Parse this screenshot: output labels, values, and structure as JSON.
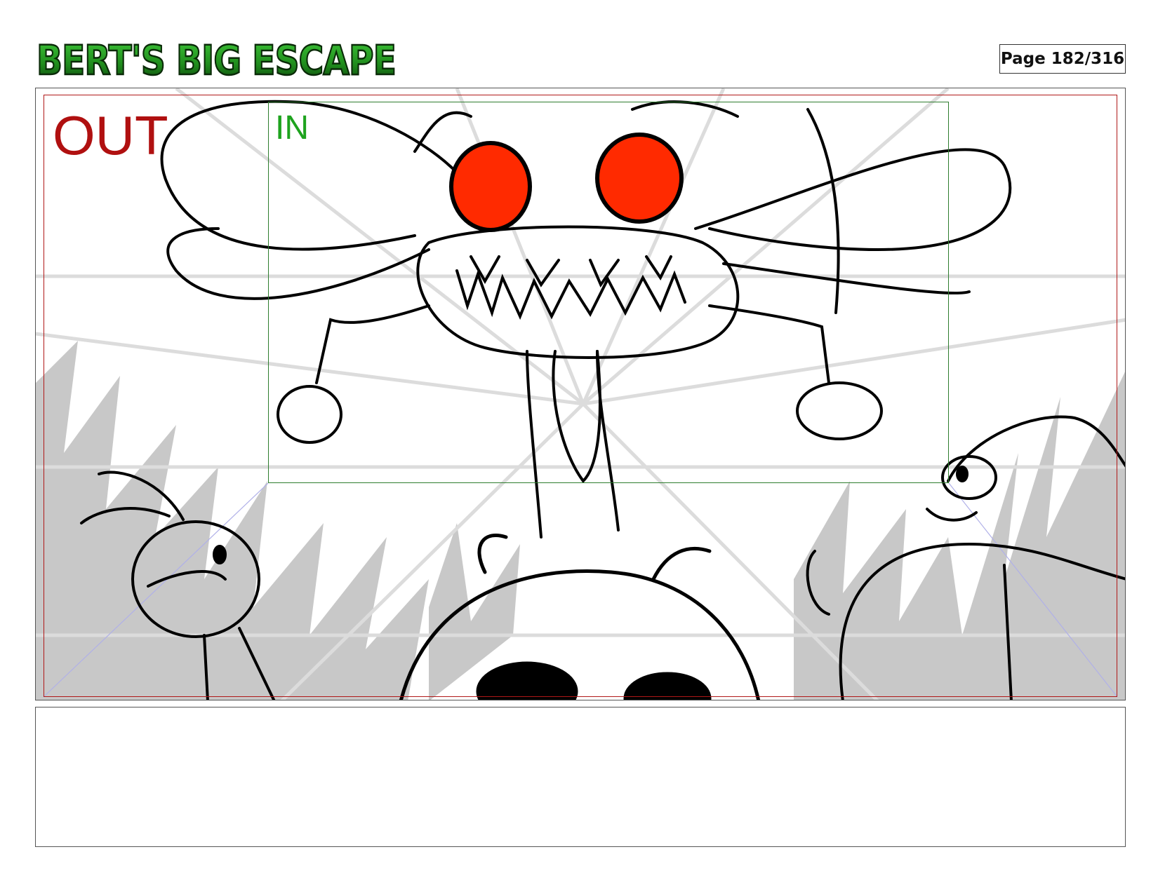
{
  "header": {
    "logo_text": "BERT'S BIG ESCAPE",
    "page_counter": "Page 182/316"
  },
  "panel": {
    "out_label": "OUT",
    "in_label": "IN",
    "eye_color": "#ff2a00",
    "out_frame_color": "#b01818",
    "in_frame_color": "#2e7d2e",
    "logo_color": "#2fa82a"
  },
  "notes": {
    "text": ""
  }
}
